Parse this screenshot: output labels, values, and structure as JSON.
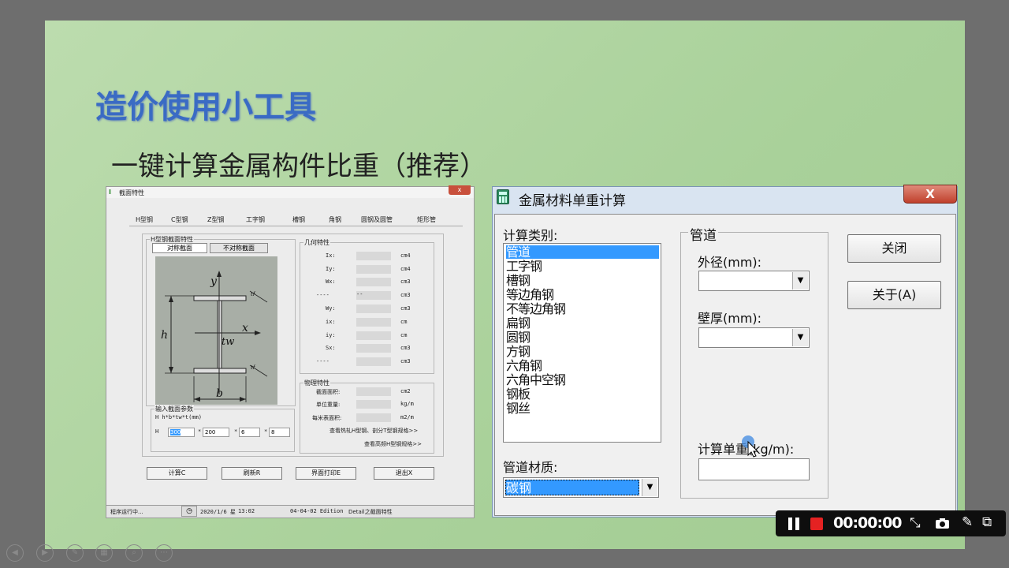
{
  "slide": {
    "title": "造价使用小工具",
    "subtitle": "一键计算金属构件比重（推荐）"
  },
  "left_window": {
    "title": "截面特性",
    "close_label": "x",
    "tabs": [
      "H型钢",
      "C型钢",
      "Z型钢",
      "工字钢",
      "槽钢",
      "角钢",
      "圆钢及圆管",
      "矩形管"
    ],
    "section_group": "H型钢截面特性",
    "sub_tabs": [
      "对称截面",
      "不对称截面"
    ],
    "drawing_labels": {
      "y": "y",
      "x": "x",
      "h": "h",
      "tw": "tw",
      "b": "b",
      "tf1": "tf",
      "tf2": "tf"
    },
    "geom_group": "几何特性",
    "geom_rows": [
      {
        "label": "Ix:",
        "value": "",
        "unit": "cm4"
      },
      {
        "label": "Iy:",
        "value": "",
        "unit": "cm4"
      },
      {
        "label": "Wx:",
        "value": "",
        "unit": "cm3"
      },
      {
        "label": "----",
        "value": "--",
        "unit": "cm3"
      },
      {
        "label": "Wy:",
        "value": "",
        "unit": "cm3"
      },
      {
        "label": "ix:",
        "value": "",
        "unit": "cm"
      },
      {
        "label": "iy:",
        "value": "",
        "unit": "cm"
      },
      {
        "label": "Sx:",
        "value": "",
        "unit": "cm3"
      },
      {
        "label": "----",
        "value": "",
        "unit": "cm3"
      }
    ],
    "phys_group": "物理特性",
    "phys_rows": [
      {
        "label": "截面面积:",
        "unit": "cm2"
      },
      {
        "label": "单位重量:",
        "unit": "kg/m"
      },
      {
        "label": "每米表面积:",
        "unit": "m2/m"
      }
    ],
    "input_group": "输入截面参数",
    "input_formula": "H   h*b*tw*t(mm)",
    "input_prefix": "H",
    "inputs": [
      "300",
      "200",
      "6",
      "8"
    ],
    "link1": "查看热轧H型钢、剖分T型钢规格>>",
    "link2": "查看高频H型钢规格>>",
    "buttons": [
      "计算C",
      "刷新R",
      "界面打印E",
      "退出X"
    ],
    "status": [
      "程序运行中...",
      "2020/1/6 星",
      "13:02",
      "04-04-02 Edition",
      "Detail之截面特性"
    ]
  },
  "right_window": {
    "title": "金属材料单重计算",
    "close_label": "X",
    "category_label": "计算类别:",
    "categories": [
      "管道",
      "工字钢",
      "槽钢",
      "等边角钢",
      "不等边角钢",
      "扁钢",
      "圆钢",
      "方钢",
      "六角钢",
      "六角中空钢",
      "钢板",
      "钢丝"
    ],
    "selected_category": 0,
    "material_label": "管道材质:",
    "material_value": "碳钢",
    "pipe_group": "管道",
    "outer_dia_label": "外径(mm):",
    "outer_dia_value": "",
    "wall_label": "壁厚(mm):",
    "wall_value": "",
    "unit_weight_label": "计算单重(kg/m):",
    "unit_weight_value": "",
    "close_button": "关闭",
    "about_button": "关于(A)"
  },
  "recorder": {
    "time": "00:00:00",
    "pause_icon": "pause-icon",
    "stop_icon": "stop-icon"
  },
  "colors": {
    "slide_bg": "#aed39f",
    "title_blue": "#3a6bc4",
    "selection": "#3399ff",
    "close_red": "#c0402c"
  }
}
